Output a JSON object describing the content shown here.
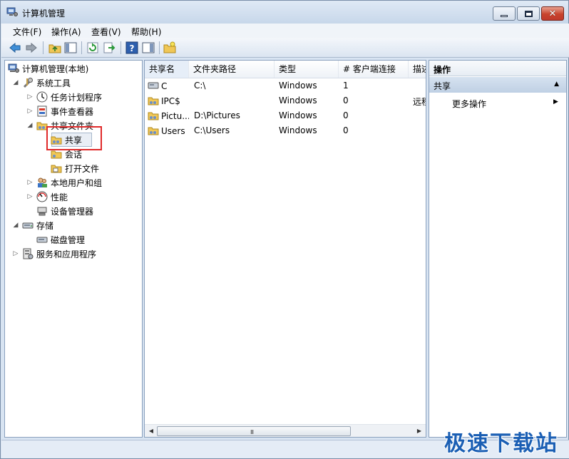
{
  "window": {
    "title": "计算机管理"
  },
  "menubar": {
    "items": [
      "文件(F)",
      "操作(A)",
      "查看(V)",
      "帮助(H)"
    ]
  },
  "toolbar": {
    "icons": [
      "back-arrow-icon",
      "forward-arrow-icon",
      "up-folder-icon",
      "show-hide-tree-icon",
      "refresh-icon",
      "export-list-icon",
      "help-icon",
      "show-hide-action-pane-icon",
      "new-share-icon"
    ]
  },
  "tree": {
    "items": [
      {
        "label": "计算机管理(本地)",
        "icon": "computer-management-icon",
        "expander": "",
        "expanded": true
      },
      {
        "label": "系统工具",
        "icon": "tools-icon",
        "expander": "▲",
        "expanded": true
      },
      {
        "label": "任务计划程序",
        "icon": "clock-icon",
        "expander": "▷"
      },
      {
        "label": "事件查看器",
        "icon": "event-viewer-icon",
        "expander": "▷"
      },
      {
        "label": "共享文件夹",
        "icon": "shared-folder-icon",
        "expander": "▲",
        "expanded": true
      },
      {
        "label": "共享",
        "icon": "share-icon",
        "expander": "",
        "selected": true
      },
      {
        "label": "会话",
        "icon": "session-icon",
        "expander": ""
      },
      {
        "label": "打开文件",
        "icon": "open-files-icon",
        "expander": ""
      },
      {
        "label": "本地用户和组",
        "icon": "users-icon",
        "expander": "▷"
      },
      {
        "label": "性能",
        "icon": "performance-icon",
        "expander": "▷"
      },
      {
        "label": "设备管理器",
        "icon": "device-manager-icon",
        "expander": ""
      },
      {
        "label": "存储",
        "icon": "storage-icon",
        "expander": "▲",
        "expanded": true
      },
      {
        "label": "磁盘管理",
        "icon": "disk-management-icon",
        "expander": ""
      },
      {
        "label": "服务和应用程序",
        "icon": "services-icon",
        "expander": "▷"
      }
    ]
  },
  "list": {
    "columns": [
      "共享名",
      "文件夹路径",
      "类型",
      "# 客户端连接",
      "描述"
    ],
    "rows": [
      {
        "name": "C",
        "path": "C:\\",
        "type": "Windows",
        "clients": "1",
        "desc": ""
      },
      {
        "name": "IPC$",
        "path": "",
        "type": "Windows",
        "clients": "0",
        "desc": "远程"
      },
      {
        "name": "Pictu...",
        "path": "D:\\Pictures",
        "type": "Windows",
        "clients": "0",
        "desc": ""
      },
      {
        "name": "Users",
        "path": "C:\\Users",
        "type": "Windows",
        "clients": "0",
        "desc": ""
      }
    ],
    "scrollbar_grip": "III"
  },
  "actions": {
    "title": "操作",
    "section": "共享",
    "item": "更多操作"
  },
  "watermark": "极速下载站",
  "colors": {
    "selection_box": "#e02a2a",
    "watermark": "#1b5fb4",
    "frame": "#d8e4f2"
  }
}
